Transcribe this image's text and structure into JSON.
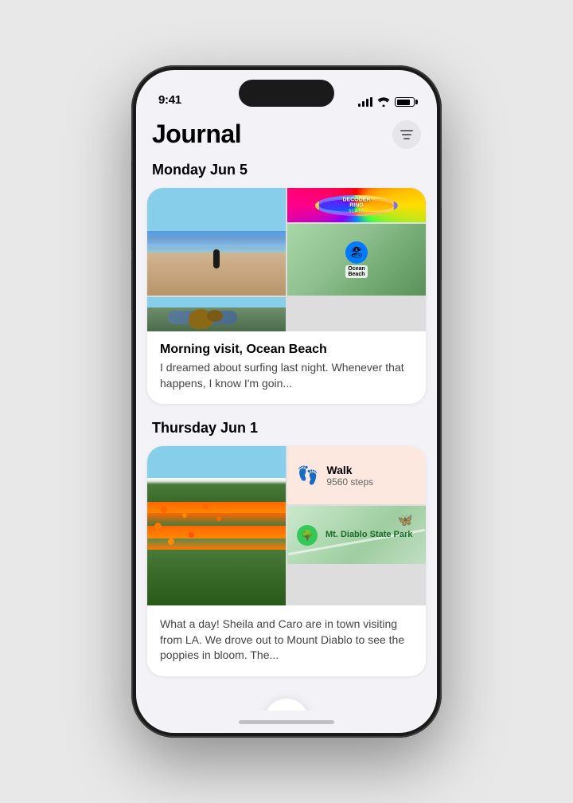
{
  "device": {
    "time": "9:41"
  },
  "app": {
    "title": "Journal",
    "filter_label": "filter"
  },
  "entries": [
    {
      "date": "Monday Jun 5",
      "title": "Morning visit, Ocean Beach",
      "preview": "I dreamed about surfing last night. Whenever that happens, I know I'm goin...",
      "photos": [
        {
          "type": "beach",
          "alt": "Person at beach"
        },
        {
          "type": "podcast",
          "label": "DECODER RING",
          "sublabel": "SLATE"
        },
        {
          "type": "map",
          "label": "Ocean Beach"
        },
        {
          "type": "dog",
          "alt": "Dog in car"
        }
      ]
    },
    {
      "date": "Thursday Jun 1",
      "activity1_title": "Walk",
      "activity1_subtitle": "9560 steps",
      "activity2_label": "Mt. Diablo State Park",
      "preview": "What a day! Sheila and Caro are in town visiting from LA. We drove out to Mount Diablo to see the poppies in bloom. The...",
      "photo_alt": "Poppy fields at Mount Diablo"
    }
  ],
  "fab": {
    "label": "+"
  }
}
